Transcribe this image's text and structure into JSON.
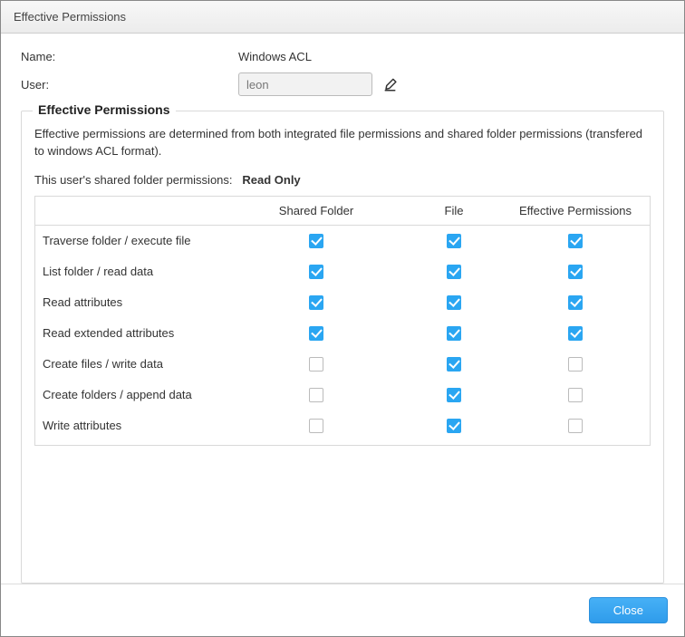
{
  "window_title": "Effective Permissions",
  "form": {
    "name_label": "Name:",
    "name_value": "Windows ACL",
    "user_label": "User:",
    "user_value": "leon"
  },
  "fieldset": {
    "legend": "Effective Permissions",
    "description": "Effective permissions are determined from both integrated file permissions and shared folder permissions (transfered to windows ACL format).",
    "shared_perm_label": "This user's shared folder permissions:",
    "shared_perm_value": "Read Only"
  },
  "table": {
    "headers": {
      "name": "",
      "shared_folder": "Shared Folder",
      "file": "File",
      "effective": "Effective Permissions"
    },
    "rows": [
      {
        "name": "Traverse folder / execute file",
        "sf": true,
        "file": true,
        "eff": true
      },
      {
        "name": "List folder / read data",
        "sf": true,
        "file": true,
        "eff": true
      },
      {
        "name": "Read attributes",
        "sf": true,
        "file": true,
        "eff": true
      },
      {
        "name": "Read extended attributes",
        "sf": true,
        "file": true,
        "eff": true
      },
      {
        "name": "Create files / write data",
        "sf": false,
        "file": true,
        "eff": false
      },
      {
        "name": "Create folders / append data",
        "sf": false,
        "file": true,
        "eff": false
      },
      {
        "name": "Write attributes",
        "sf": false,
        "file": true,
        "eff": false
      }
    ]
  },
  "footer": {
    "close_label": "Close"
  }
}
